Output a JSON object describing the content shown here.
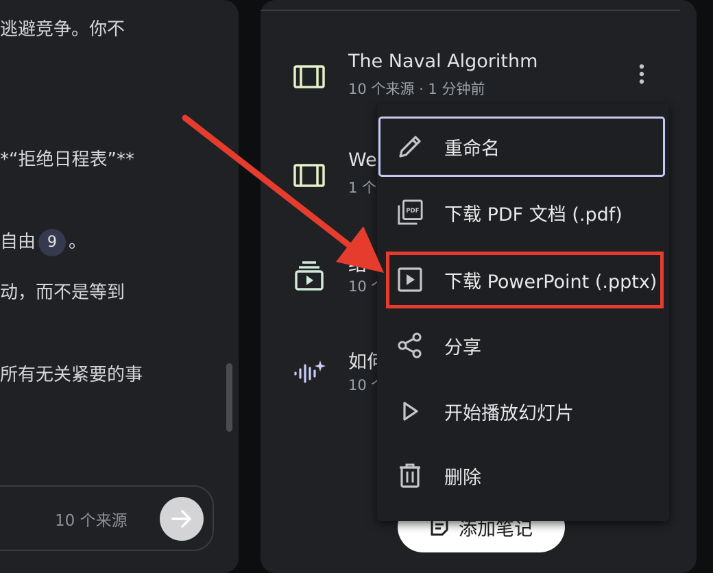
{
  "chat": {
    "lines": [
      "逃避竞争。你不",
      "*“拒绝日程表”**",
      "自由",
      "动，而不是等到",
      "所有无关紧要的事"
    ],
    "citation": "9",
    "after_citation": "。",
    "source_count": "10 个来源"
  },
  "notes": [
    {
      "title": "The Naval Algorithm",
      "subtitle": "10 个来源 · 1 分钟前",
      "icon": "slides-icon"
    },
    {
      "title": "We",
      "subtitle": "1 个",
      "icon": "slides-icon"
    },
    {
      "title": "结",
      "subtitle": "10 个",
      "icon": "video-overview-icon"
    },
    {
      "title": "如何",
      "subtitle": "10 个",
      "icon": "audio-overview-icon"
    }
  ],
  "add_note_label": "添加笔记",
  "menu": {
    "items": [
      {
        "label": "重命名",
        "icon": "pencil-icon"
      },
      {
        "label": "下载 PDF 文档 (.pdf)",
        "icon": "pdf-icon"
      },
      {
        "label": "下载 PowerPoint (.pptx)",
        "icon": "slideshow-icon"
      },
      {
        "label": "分享",
        "icon": "share-icon"
      },
      {
        "label": "开始播放幻灯片",
        "icon": "play-icon"
      },
      {
        "label": "删除",
        "icon": "trash-icon"
      }
    ]
  },
  "colors": {
    "annotation": "#e53c2e",
    "focus": "#c7c9f5",
    "slides_icon": "#e6f0c8",
    "video_icon": "#cfead9",
    "audio_icon": "#c9ccf5"
  }
}
